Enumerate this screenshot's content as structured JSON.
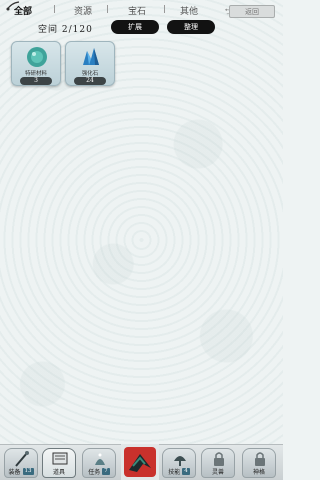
{
  "tabs": [
    {
      "label": "全部",
      "active": true
    },
    {
      "label": "资源",
      "active": false
    },
    {
      "label": "宝石",
      "active": false
    },
    {
      "label": "其他",
      "active": false
    }
  ],
  "back_label": "返回",
  "space": {
    "label": "空间",
    "value": "2/120"
  },
  "buttons": {
    "expand": "扩展",
    "sort": "整理"
  },
  "items": [
    {
      "name": "特研材料",
      "count": "3",
      "icon": "teal-orb-icon"
    },
    {
      "name": "强化石",
      "count": "24",
      "icon": "blue-crystal-icon"
    }
  ],
  "nav": [
    {
      "label": "装备",
      "badge": "13",
      "icon": "brush-pen-icon"
    },
    {
      "label": "道具",
      "badge": "",
      "icon": "scroll-icon"
    },
    {
      "label": "任务",
      "badge": "7",
      "icon": "sparkle-bag-icon"
    },
    {
      "label": "",
      "badge": "",
      "icon": "red-phoenix-icon"
    },
    {
      "label": "技能",
      "badge": "4",
      "icon": "tree-icon"
    },
    {
      "label": "灵兽",
      "badge": "",
      "icon": "lock-icon"
    },
    {
      "label": "神格",
      "badge": "",
      "icon": "lock-icon"
    }
  ],
  "colors": {
    "accent": "#3a6b7f",
    "pill": "#121212",
    "background": "#eef3f3"
  }
}
